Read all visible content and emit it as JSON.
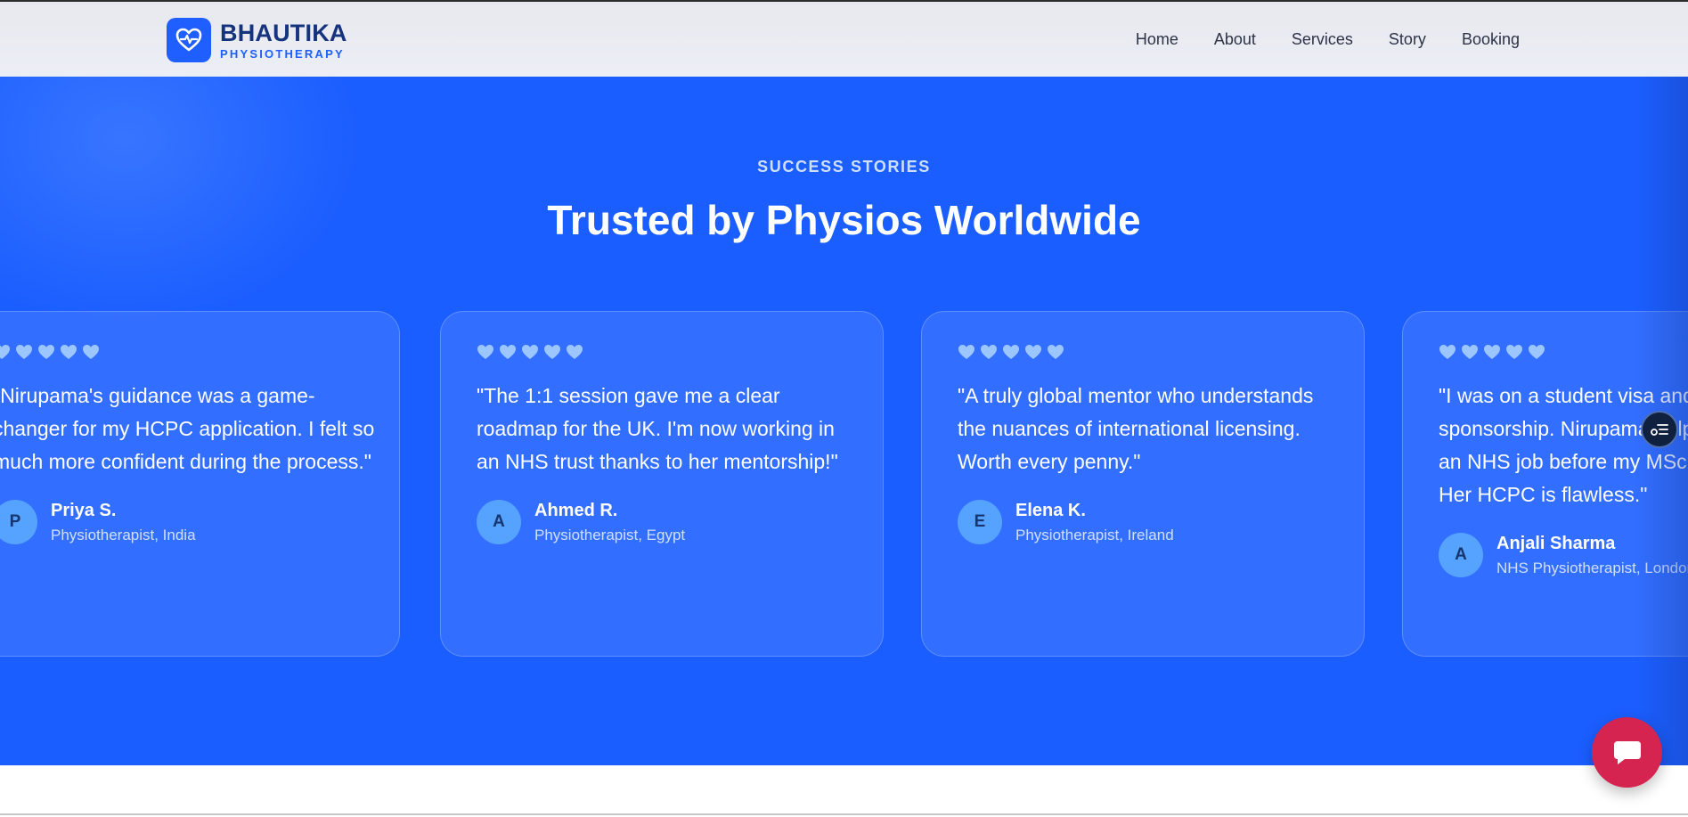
{
  "brand": {
    "name": "BHAUTIKA",
    "subtitle": "PHYSIOTHERAPY",
    "icon": "heart-pulse-icon",
    "accent_color": "#1f5eff"
  },
  "nav": {
    "items": [
      "Home",
      "About",
      "Services",
      "Story",
      "Booking"
    ]
  },
  "stories": {
    "eyebrow": "SUCCESS STORIES",
    "title": "Trusted by Physios Worldwide",
    "background_color": "#1b5eff",
    "rating_icon": "heart-icon",
    "cards": [
      {
        "rating": 5,
        "quote": "\"Nirupama's guidance was a game-changer for my HCPC application. I felt so much more confident during the process.\"",
        "initial": "P",
        "name": "Priya S.",
        "role": "Physiotherapist, India"
      },
      {
        "rating": 5,
        "quote": "\"The 1:1 session gave me a clear roadmap for the UK. I'm now working in an NHS trust thanks to her mentorship!\"",
        "initial": "A",
        "name": "Ahmed R.",
        "role": "Physiotherapist, Egypt"
      },
      {
        "rating": 5,
        "quote": "\"A truly global mentor who understands the nuances of international licensing. Worth every penny.\"",
        "initial": "E",
        "name": "Elena K.",
        "role": "Physiotherapist, Ireland"
      },
      {
        "rating": 5,
        "quote": "\"I was on a student visa and about sponsorship. Nirupama helped me land an NHS job before my MSc even finished! Her HCPC is flawless.\"",
        "initial": "A",
        "name": "Anjali Sharma",
        "role": "NHS Physiotherapist, London"
      }
    ]
  },
  "floating": {
    "reader_icon": "reader-mode-icon",
    "chat_icon": "chat-bubble-icon",
    "chat_color": "#d62450"
  }
}
